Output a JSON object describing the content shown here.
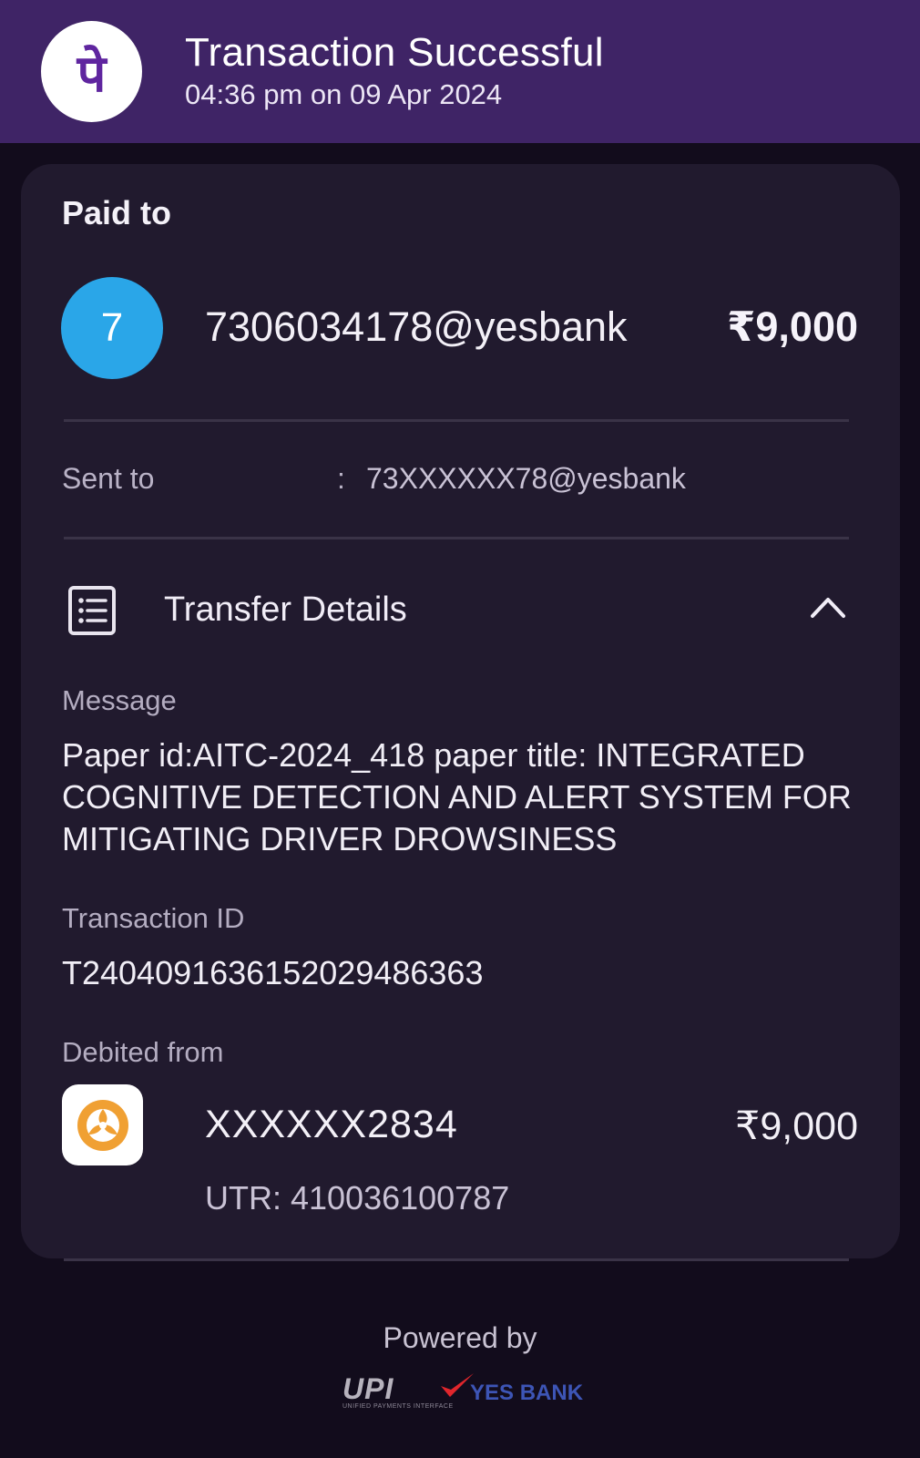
{
  "header": {
    "title": "Transaction Successful",
    "timestamp": "04:36 pm on 09 Apr 2024",
    "logo_glyph": "पे"
  },
  "paid_to": {
    "label": "Paid to",
    "avatar_initial": "7",
    "payee": "7306034178@yesbank",
    "amount": "₹9,000"
  },
  "sent_to": {
    "label": "Sent to",
    "separator": ":",
    "value": "73XXXXXX78@yesbank"
  },
  "transfer_details": {
    "title": "Transfer Details",
    "message_label": "Message",
    "message": "Paper id:AITC-2024_418 paper title: INTEGRATED COGNITIVE DETECTION AND ALERT SYSTEM FOR MITIGATING DRIVER DROWSINESS",
    "transaction_id_label": "Transaction ID",
    "transaction_id": "T2404091636152029486363",
    "debited_from_label": "Debited from",
    "account": "XXXXXX2834",
    "debit_amount": "₹9,000",
    "utr": "UTR: 410036100787"
  },
  "footer": {
    "powered_by": "Powered by",
    "upi_logo_text": "UPI",
    "upi_sub": "UNIFIED PAYMENTS INTERFACE",
    "bank_name": "YES BANK"
  },
  "colors": {
    "header_bg": "#3f2466",
    "page_bg": "#120c1c",
    "card_bg": "#211a2e",
    "avatar_bg": "#2aa6e8",
    "phonepe_purple": "#5f259f",
    "bank_logo_orange": "#f0a033",
    "yes_bank_blue": "#3d55b6",
    "yes_tick_red": "#e0262c"
  },
  "icons": {
    "logo": "phonepe-logo-icon",
    "details": "receipt-list-icon",
    "collapse": "chevron-up-icon",
    "bank": "icici-bank-logo-icon",
    "tick": "yes-bank-tick-icon"
  }
}
